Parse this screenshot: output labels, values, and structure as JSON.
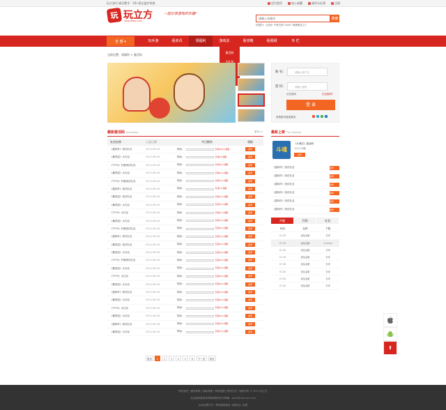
{
  "topbar": {
    "left_text": "玩大游乐·娱乐数字 · 18+家长监护系统",
    "links": [
      "设为首页",
      "加入收藏",
      "请问与反馈",
      "注册"
    ]
  },
  "header": {
    "logo_mark": "玩",
    "logo_text": "玩立方",
    "logo_sub": "WANLIFANG.COM",
    "slogan": "一起分享游戏的乐趣!",
    "search_placeholder": "请输入关键词",
    "search_button": "搜索",
    "hot_words": "热搜词：大游乐 千奇古怪 52887 暗黑魔法之2"
  },
  "nav": {
    "all_games": "全 部 ▾",
    "items": [
      "玩手游",
      "看资讯",
      "领福利",
      "游戏关",
      "看攻略",
      "看视频",
      "专 栏"
    ]
  },
  "dropdown": {
    "items": [
      "激活码",
      "大礼包",
      "新手卡",
      "独家卡"
    ]
  },
  "breadcrumb": "当前位置：领福利 > 激活码",
  "login": {
    "account_label": "账 号：",
    "account_placeholder": "请输入账户名",
    "password_label": "密 码：",
    "password_placeholder": "请输入密码",
    "remember": "记住密码",
    "forgot": "忘记密码？",
    "login_button": "登 录",
    "third_party": "其他账号直接登录："
  },
  "activation": {
    "title": "最新激活码",
    "subtitle": "Activation",
    "more": "更多>>",
    "headers": [
      "礼包名称",
      "上架日期",
      "今日剩余",
      "领取"
    ],
    "remaining_label": "剩余：",
    "rows": [
      {
        "name": "《星辉外》测试礼包",
        "date": "2014-06-18",
        "claimed": "已领100人领取",
        "btn": "领号"
      },
      {
        "name": "《暴怒岩》大礼包",
        "date": "2014-06-18",
        "claimed": "已领0人领取",
        "btn": "领号"
      },
      {
        "name": "《TFP4》开服测试礼包",
        "date": "2014-06-18",
        "claimed": "已领10人领取",
        "btn": "领号"
      },
      {
        "name": "《暴怒岩》大礼包",
        "date": "2014-06-18",
        "claimed": "已领21人领取",
        "btn": "领号"
      },
      {
        "name": "《TFP4》开服测试礼包",
        "date": "2014-06-18",
        "claimed": "已领11人领取",
        "btn": "领号"
      },
      {
        "name": "《星辉外》测试礼包",
        "date": "2014-06-18",
        "claimed": "已领1人领取",
        "btn": "领号"
      },
      {
        "name": "《暴怒岩》测试礼包",
        "date": "2014-06-18",
        "claimed": "已领21人领取",
        "btn": "领号"
      },
      {
        "name": "《暴怒岩》大礼包",
        "date": "2014-06-18",
        "claimed": "已领21人领取",
        "btn": "领号"
      },
      {
        "name": "《TFP4》大礼包",
        "date": "2014-06-18",
        "claimed": "已领21人领取",
        "btn": "领号"
      },
      {
        "name": "《暴怒岩》大礼包",
        "date": "2014-06-18",
        "claimed": "已领21人领取",
        "btn": "领号"
      },
      {
        "name": "《TFP4》开服测试礼包",
        "date": "2014-06-18",
        "claimed": "已领21人领取",
        "btn": "领号"
      },
      {
        "name": "《星辉外》测试礼包",
        "date": "2014-06-18",
        "claimed": "已领21人领取",
        "btn": "领号"
      },
      {
        "name": "《暴怒岩》测试礼包",
        "date": "2014-06-18",
        "claimed": "已领21人领取",
        "btn": "领号"
      },
      {
        "name": "《暴怒岩》大礼包",
        "date": "2014-06-18",
        "claimed": "已领21人领取",
        "btn": "领号"
      },
      {
        "name": "《TFP4》开服测试礼包",
        "date": "2014-06-18",
        "claimed": "已领21人领取",
        "btn": "领号"
      },
      {
        "name": "《暴怒岩》大礼包",
        "date": "2014-06-18",
        "claimed": "已领21人领取",
        "btn": "领号"
      },
      {
        "name": "《TFP4》大礼包",
        "date": "2014-06-18",
        "claimed": "已领21人领取",
        "btn": "领号"
      },
      {
        "name": "《暴怒岩》大礼包",
        "date": "2014-06-18",
        "claimed": "已领21人领取",
        "btn": "领号"
      },
      {
        "name": "《星辉外》测试礼包",
        "date": "2014-06-18",
        "claimed": "已领21人领取",
        "btn": "领号"
      },
      {
        "name": "《暴怒岩》大礼包",
        "date": "2014-06-18",
        "claimed": "已领21人领取",
        "btn": "领号"
      },
      {
        "name": "《TFP4》大礼包",
        "date": "2014-06-18",
        "claimed": "已领21人领取",
        "btn": "领号"
      },
      {
        "name": "《暴怒岩》大礼包",
        "date": "2014-06-18",
        "claimed": "已领21人领取",
        "btn": "领号"
      },
      {
        "name": "《星辉外》测试礼包",
        "date": "2014-06-18",
        "claimed": "已领21人领取",
        "btn": "领号"
      },
      {
        "name": "《暴怒岩》大礼包",
        "date": "2014-06-18",
        "claimed": "已领21人领取",
        "btn": "领号"
      }
    ]
  },
  "pager": [
    "首页",
    "1",
    "2",
    "3",
    "4",
    "5",
    "6",
    "下一页",
    "末页"
  ],
  "newgames": {
    "title": "最新上架",
    "subtitle": "The Shelves",
    "game_name": "《斗魂王》激活码",
    "game_count": "100人领取",
    "game_btn": "领号",
    "game_logo": "斗魂",
    "gifts": [
      {
        "name": "《星辉外》测试礼包",
        "btn": "领号"
      },
      {
        "name": "《星辉外》测试礼包",
        "btn": "领号"
      },
      {
        "name": "《星辉外》测试礼包",
        "btn": "领号"
      },
      {
        "name": "《星辉外》测试礼包",
        "btn": "领号"
      },
      {
        "name": "《星辉外》测试礼包",
        "btn": "领号"
      },
      {
        "name": "《星辉外》测试礼包",
        "btn": "领号"
      }
    ]
  },
  "schedule": {
    "tabs": [
      "开服",
      "开测",
      "礼包"
    ],
    "headers": [
      "时间",
      "名称",
      "下载"
    ],
    "rows": [
      {
        "time": "07-28",
        "name": "魔兔温暖",
        "dl": "安卓"
      },
      {
        "time": "07-28",
        "name": "魔兔温暖",
        "dl": "Android"
      },
      {
        "time": "07-28",
        "name": "魔兔温暖",
        "dl": "安卓"
      },
      {
        "time": "07-28",
        "name": "魔兔温暖",
        "dl": "安卓"
      },
      {
        "time": "07-28",
        "name": "魔兔温暖",
        "dl": "安卓"
      },
      {
        "time": "07-28",
        "name": "魔兔温暖",
        "dl": "安卓"
      },
      {
        "time": "07-28",
        "name": "魔兔温暖",
        "dl": "安卓"
      },
      {
        "time": "07-28",
        "name": "魔兔温暖",
        "dl": "安卓"
      }
    ]
  },
  "side": {
    "apple": "",
    "android": "🤖",
    "top": "⬆"
  },
  "footer": {
    "line1": "联系我们 | 服务条款 | 隐私政策 | 网站地图 | 联系方式 · 版权所有 © 2014 玩立方",
    "line2": "文化部网络游戏举报和联系电子邮箱：wlwh@vip.sina.com",
    "line3": "纠纷处理方式：联系客服或依《版权法》处理"
  },
  "colors": {
    "brand_red": "#d7261f",
    "accent_orange": "#f26522"
  }
}
